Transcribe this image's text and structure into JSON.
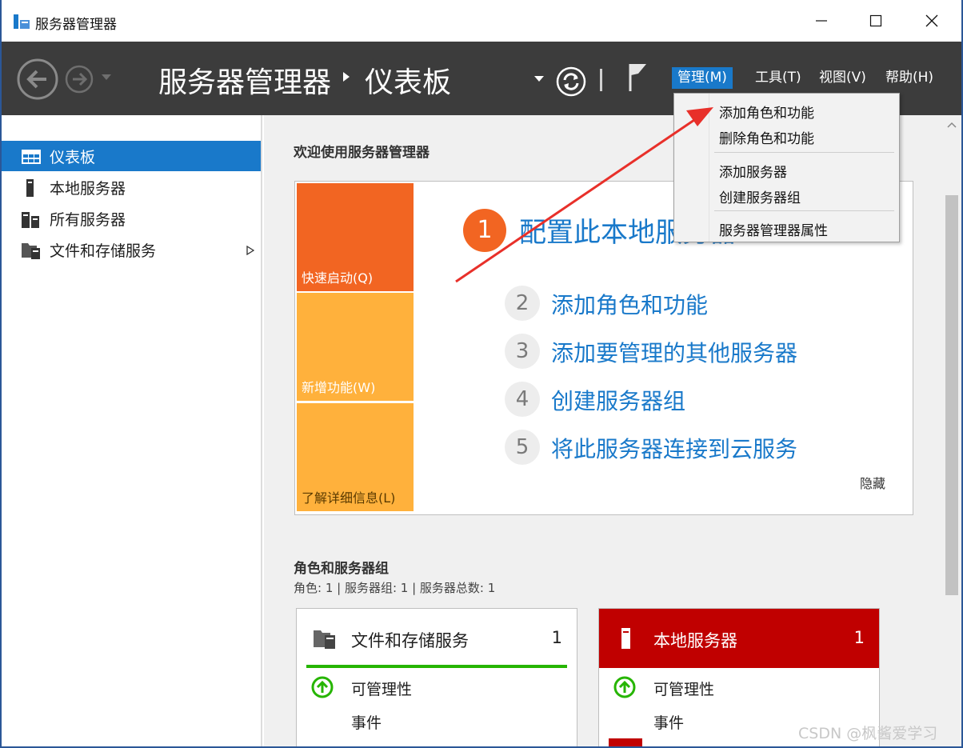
{
  "window": {
    "title": "服务器管理器"
  },
  "header": {
    "breadcrumb_root": "服务器管理器",
    "breadcrumb_page": "仪表板",
    "menus": {
      "manage": "管理(M)",
      "tools": "工具(T)",
      "view": "视图(V)",
      "help": "帮助(H)"
    }
  },
  "sidebar": {
    "items": [
      {
        "label": "仪表板",
        "icon": "dashboard-icon",
        "selected": true
      },
      {
        "label": "本地服务器",
        "icon": "server-icon"
      },
      {
        "label": "所有服务器",
        "icon": "servers-icon"
      },
      {
        "label": "文件和存储服务",
        "icon": "file-storage-icon",
        "has_submenu": true
      }
    ]
  },
  "welcome": {
    "title": "欢迎使用服务器管理器",
    "tiles": {
      "quick_start": "快速启动(Q)",
      "whats_new": "新增功能(W)",
      "learn_more": "了解详细信息(L)"
    },
    "step1": {
      "num": "1",
      "text": "配置此本地服务器"
    },
    "steps": [
      {
        "num": "2",
        "text": "添加角色和功能"
      },
      {
        "num": "3",
        "text": "添加要管理的其他服务器"
      },
      {
        "num": "4",
        "text": "创建服务器组"
      },
      {
        "num": "5",
        "text": "将此服务器连接到云服务"
      }
    ],
    "hide": "隐藏"
  },
  "roles": {
    "title": "角色和服务器组",
    "summary": "角色: 1 | 服务器组: 1 | 服务器总数: 1",
    "cards": [
      {
        "name": "文件和存储服务",
        "count": "1",
        "manageability": "可管理性",
        "events": "事件"
      },
      {
        "name": "本地服务器",
        "count": "1",
        "manageability": "可管理性",
        "events": "事件"
      }
    ]
  },
  "manage_menu": {
    "items": [
      "添加角色和功能",
      "删除角色和功能",
      "添加服务器",
      "创建服务器组",
      "服务器管理器属性"
    ]
  },
  "watermark": "CSDN @枫酱爱学习",
  "colors": {
    "accent": "#1979ca",
    "header_bg": "#3c3c3c",
    "tile_orange": "#f26522",
    "tile_yellow": "#ffb13c",
    "local_red": "#c00000",
    "ok_green": "#26b500",
    "annotation_arrow": "#e8302a"
  }
}
